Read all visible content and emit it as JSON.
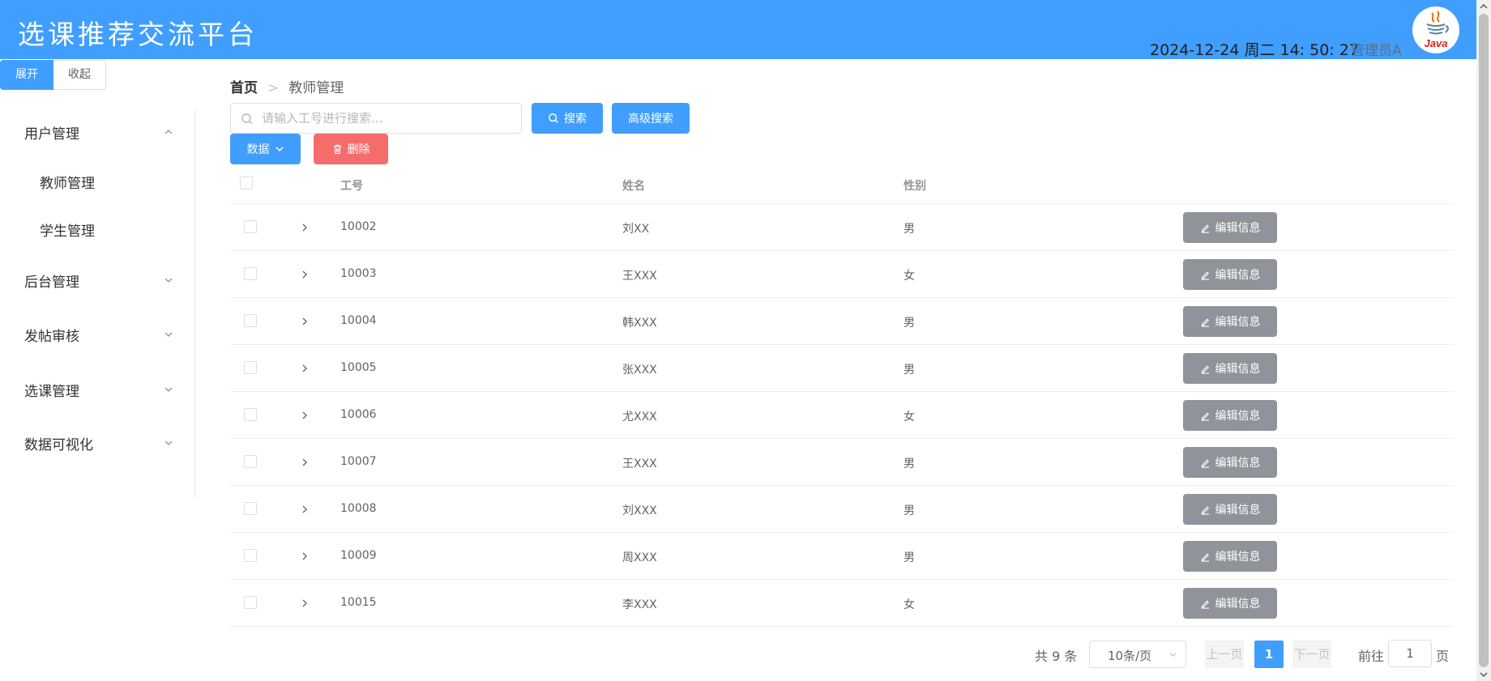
{
  "header": {
    "title": "选课推荐交流平台",
    "datetime": "2024-12-24 周二 14: 50: 27",
    "user": "管理员A",
    "avatar_text": "Java",
    "avatar_icon": "java-logo-icon"
  },
  "collapse": {
    "expand_label": "展开",
    "collapse_label": "收起"
  },
  "sidebar": {
    "items": [
      {
        "label": "用户管理",
        "expanded": true,
        "children": [
          "教师管理",
          "学生管理"
        ]
      },
      {
        "label": "后台管理",
        "expanded": false
      },
      {
        "label": "发帖审核",
        "expanded": false
      },
      {
        "label": "选课管理",
        "expanded": false
      },
      {
        "label": "数据可视化",
        "expanded": false
      }
    ]
  },
  "breadcrumb": {
    "home": "首页",
    "separator": ">",
    "current": "教师管理"
  },
  "toolbar": {
    "search_placeholder": "请输入工号进行搜索...",
    "search_label": "搜索",
    "advanced_label": "高级搜索",
    "data_label": "数据",
    "delete_label": "删除"
  },
  "table": {
    "columns": [
      "工号",
      "姓名",
      "性别"
    ],
    "edit_label": "编辑信息",
    "rows": [
      {
        "id": "10002",
        "name": "刘XX",
        "gender": "男"
      },
      {
        "id": "10003",
        "name": "王XXX",
        "gender": "女"
      },
      {
        "id": "10004",
        "name": "韩XXX",
        "gender": "男"
      },
      {
        "id": "10005",
        "name": "张XXX",
        "gender": "男"
      },
      {
        "id": "10006",
        "name": "尤XXX",
        "gender": "女"
      },
      {
        "id": "10007",
        "name": "王XXX",
        "gender": "男"
      },
      {
        "id": "10008",
        "name": "刘XXX",
        "gender": "男"
      },
      {
        "id": "10009",
        "name": "周XXX",
        "gender": "男"
      },
      {
        "id": "10015",
        "name": "李XXX",
        "gender": "女"
      }
    ]
  },
  "pagination": {
    "total": "共 9 条",
    "page_size": "10条/页",
    "prev": "上一页",
    "current_page": "1",
    "next": "下一页",
    "goto_prefix": "前往",
    "goto_value": "1",
    "goto_suffix": "页"
  },
  "colors": {
    "primary": "#409eff",
    "danger": "#f56c6c",
    "neutral": "#909399"
  }
}
